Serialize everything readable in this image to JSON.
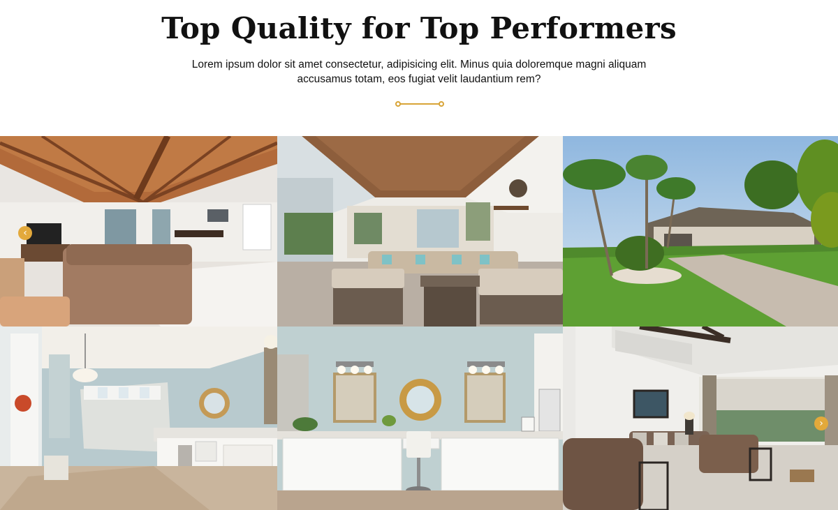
{
  "section": {
    "title": "Top Quality for Top Performers",
    "subtitle": "Lorem ipsum dolor sit amet consectetur, adipisicing elit. Minus quia doloremque magni aliquam accusamus totam, eos fugiat velit laudantium rem?"
  },
  "colors": {
    "accent": "#d8a437",
    "arrow": "#e3a93b",
    "title": "#111111"
  },
  "carousel": {
    "prev_icon": "‹",
    "next_icon": "›"
  },
  "gallery": {
    "photos": [
      "living-room-wood-ceiling",
      "covered-patio-outdoor-lounge",
      "house-exterior-palm-trees",
      "master-bathroom-double-vanity",
      "bathroom-vanity-round-mirrors",
      "bedroom-sitting-area"
    ]
  }
}
